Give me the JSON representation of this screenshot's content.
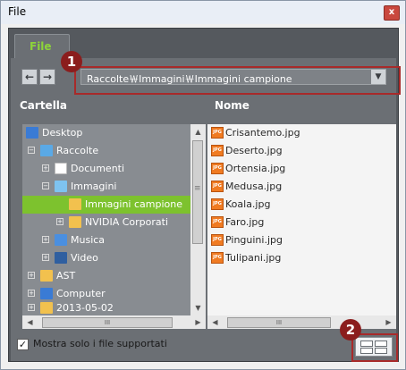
{
  "window": {
    "title": "File",
    "close_glyph": "x"
  },
  "tab": {
    "label": "File"
  },
  "nav": {
    "back_glyph": "←",
    "forward_glyph": "→"
  },
  "path": {
    "value": "Raccolte￦Immagini￦Immagini campione",
    "dropdown_glyph": "▼"
  },
  "columns": {
    "left": "Cartella",
    "right": "Nome"
  },
  "tree": [
    {
      "label": "Desktop",
      "icon": "desktop-icon",
      "color": "#3a7bd5"
    },
    {
      "label": "Raccolte",
      "icon": "library-icon",
      "color": "#5aa9e6"
    },
    {
      "label": "Documenti",
      "icon": "documents-icon",
      "color": "#ffffff"
    },
    {
      "label": "Immagini",
      "icon": "pictures-icon",
      "color": "#7ec3f0"
    },
    {
      "label": "Immagini campione",
      "icon": "folder-icon",
      "color": "#f2c14e"
    },
    {
      "label": "NVIDIA Corporati",
      "icon": "folder-icon",
      "color": "#f2c14e"
    },
    {
      "label": "Musica",
      "icon": "music-icon",
      "color": "#4a8fe0"
    },
    {
      "label": "Video",
      "icon": "video-icon",
      "color": "#2f5fa0"
    },
    {
      "label": "AST",
      "icon": "user-folder-icon",
      "color": "#f2c14e"
    },
    {
      "label": "Computer",
      "icon": "computer-icon",
      "color": "#3a7bd5"
    },
    {
      "label": "2013-05-02",
      "icon": "folder-icon",
      "color": "#f2c14e"
    }
  ],
  "files": [
    {
      "name": "Crisantemo.jpg"
    },
    {
      "name": "Deserto.jpg"
    },
    {
      "name": "Ortensia.jpg"
    },
    {
      "name": "Medusa.jpg"
    },
    {
      "name": "Koala.jpg"
    },
    {
      "name": "Faro.jpg"
    },
    {
      "name": "Pinguini.jpg"
    },
    {
      "name": "Tulipani.jpg"
    }
  ],
  "file_badge": "JPG",
  "scroll": {
    "up": "▲",
    "down": "▼",
    "left": "◀",
    "right": "▶",
    "grip": "III",
    "mid_grip": "≡"
  },
  "tree_toggles": {
    "collapse": "−",
    "expand": "+"
  },
  "footer": {
    "checkbox_label": "Mostra solo i file supportati",
    "check_glyph": "✓",
    "checked": true
  },
  "callouts": {
    "one": "1",
    "two": "2"
  },
  "colors": {
    "accent_green": "#7dc22e",
    "callout_red": "#8b1d1d",
    "panel_dark": "#55595e"
  }
}
